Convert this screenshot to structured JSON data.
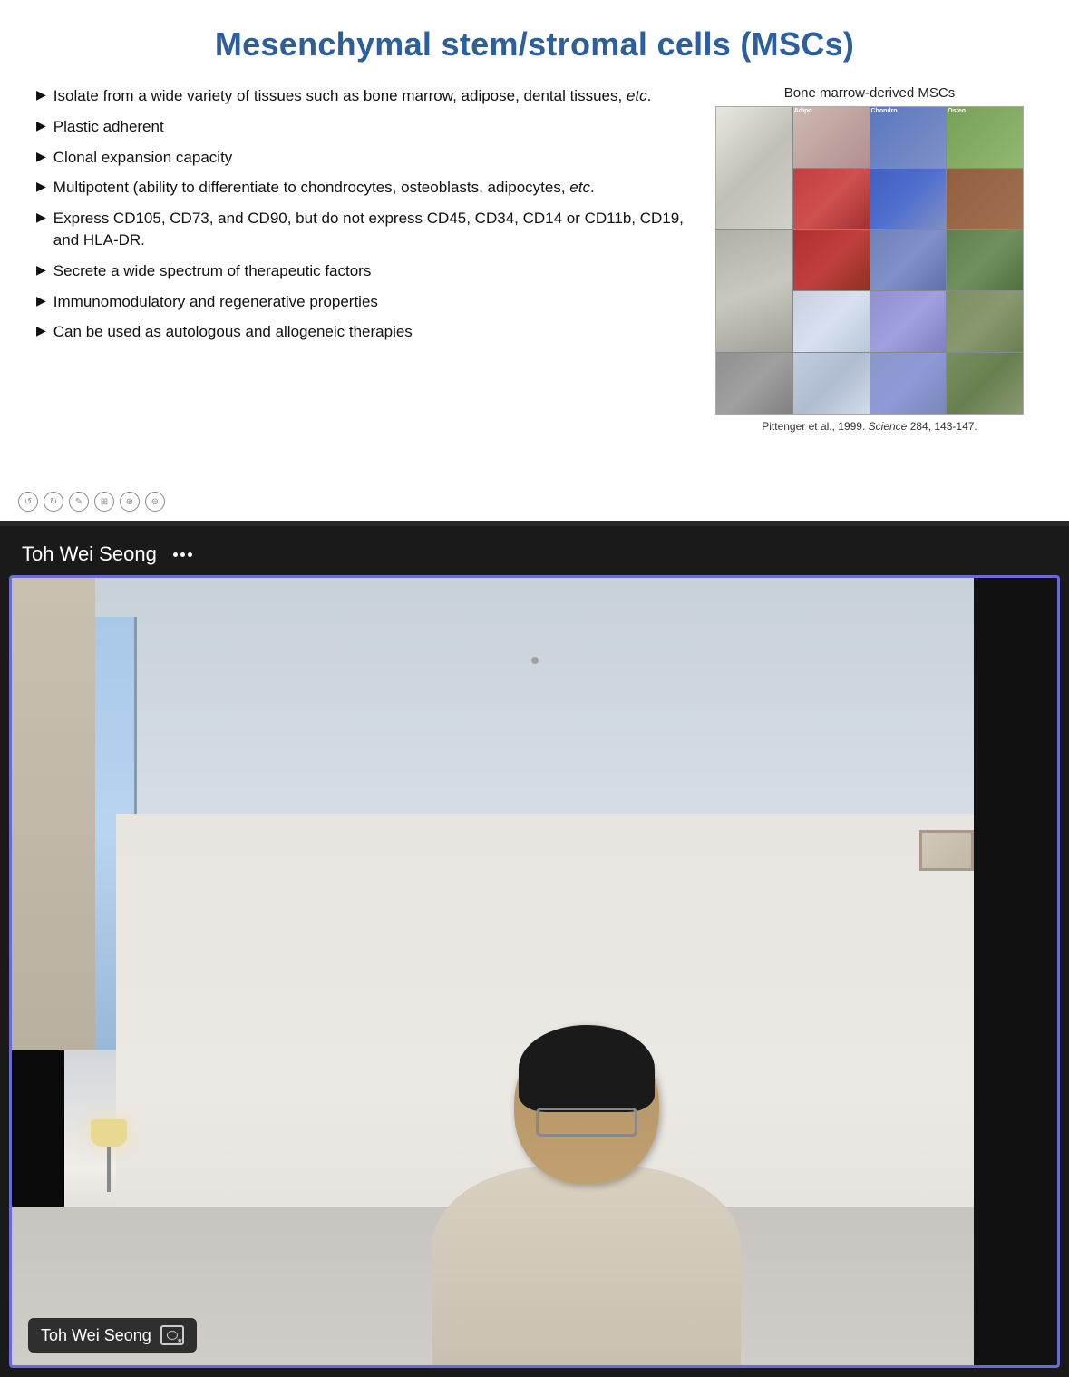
{
  "slide": {
    "title": "Mesenchymal stem/stromal cells (MSCs)",
    "bullets": [
      {
        "id": "bullet-1",
        "text": "Isolate from a wide variety of tissues such as bone marrow, adipose, dental tissues, ",
        "italic": "etc"
      },
      {
        "id": "bullet-2",
        "text": "Plastic adherent",
        "italic": ""
      },
      {
        "id": "bullet-3",
        "text": "Clonal expansion capacity",
        "italic": ""
      },
      {
        "id": "bullet-4",
        "text": "Multipotent (ability to differentiate to chondrocytes, osteoblasts, adipocytes, ",
        "italic": "etc"
      },
      {
        "id": "bullet-5",
        "text": "Express CD105, CD73, and CD90, but do not express CD45, CD34, CD14 or CD11b, CD19, and HLA-DR.",
        "italic": ""
      },
      {
        "id": "bullet-6",
        "text": "Secrete a wide spectrum of therapeutic factors",
        "italic": ""
      },
      {
        "id": "bullet-7",
        "text": "Immunomodulatory and regenerative properties",
        "italic": ""
      },
      {
        "id": "bullet-8",
        "text": "Can be used as autologous and allogeneic therapies",
        "italic": ""
      }
    ],
    "image_label": "Bone marrow-derived MSCs",
    "citation": "Pittenger et al., 1999. Science 284, 143-147.",
    "citation_italic": "Science"
  },
  "controls": {
    "buttons": [
      "↺",
      "↻",
      "✎",
      "⧉",
      "⊕",
      "⊖"
    ]
  },
  "video": {
    "presenter_name": "Toh Wei Seong",
    "more_options_label": "•••",
    "overlay_name": "Toh Wei Seong"
  }
}
